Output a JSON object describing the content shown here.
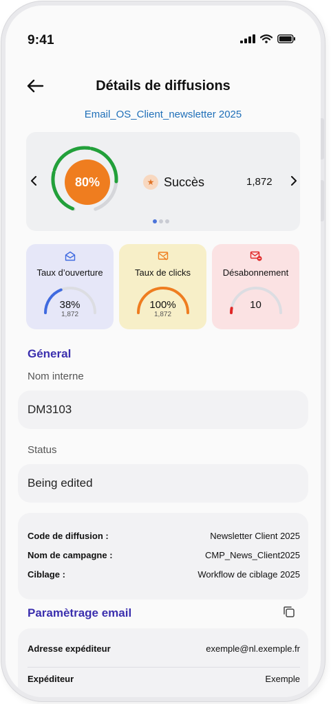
{
  "status_bar": {
    "time": "9:41"
  },
  "header": {
    "title": "Détails de diffusions",
    "subtitle": "Email_OS_Client_newsletter 2025"
  },
  "success_card": {
    "percent_label": "80%",
    "percent_value": 80,
    "label": "Succès",
    "count": "1,872",
    "page_dots": 3,
    "active_dot": 0
  },
  "metrics": [
    {
      "label": "Taux d’ouverture",
      "value": "38%",
      "sub": "1,872",
      "level": 0.38,
      "color": "#3f6ae0",
      "bg": "#e6e7f8",
      "icon": "envelope-open-icon"
    },
    {
      "label": "Taux de clicks",
      "value": "100%",
      "sub": "1,872",
      "level": 1.0,
      "color": "#ef7d1f",
      "bg": "#f7efc8",
      "icon": "click-mail-icon"
    },
    {
      "label": "Désabonnement",
      "value": "10",
      "sub": "",
      "level": 0.06,
      "color": "#e02626",
      "bg": "#fbe2e3",
      "icon": "unsubscribe-mail-icon"
    }
  ],
  "general": {
    "section_title": "Géneral",
    "internal_name_label": "Nom interne",
    "internal_name_value": "DM3103",
    "status_label": "Status",
    "status_value": "Being edited",
    "info": [
      {
        "key": "Code de diffusion :",
        "value": "Newsletter Client 2025"
      },
      {
        "key": "Nom de campagne :",
        "value": "CMP_News_Client2025"
      },
      {
        "key": "Ciblage :",
        "value": "Workflow de ciblage 2025"
      }
    ]
  },
  "email_settings": {
    "section_title": "Paramètrage email",
    "rows": [
      {
        "key": "Adresse expéditeur",
        "value": "exemple@nl.exemple.fr"
      },
      {
        "key": "Expéditeur",
        "value": "Exemple"
      }
    ]
  },
  "colors": {
    "accent_blue": "#1f6fb8",
    "section_purple": "#3b2fae",
    "success_green": "#22a03a",
    "success_orange": "#ef7d1f"
  }
}
